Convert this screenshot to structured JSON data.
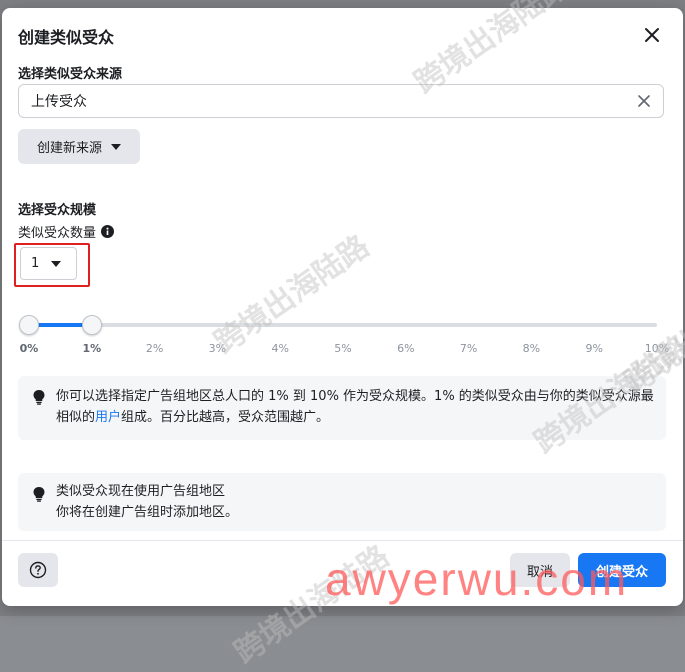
{
  "dialog": {
    "title": "创建类似受众",
    "source": {
      "label": "选择类似受众来源",
      "value": "上传受众",
      "new_source_button": "创建新来源"
    },
    "size": {
      "label": "选择受众规模",
      "count_label": "类似受众数量",
      "count_value": "1",
      "slider": {
        "ticks": [
          "0%",
          "1%",
          "2%",
          "3%",
          "4%",
          "5%",
          "6%",
          "7%",
          "8%",
          "9%",
          "10%"
        ],
        "range_start_percent": 0,
        "range_end_percent": 1
      }
    },
    "info1": {
      "text_before_link": "你可以选择指定广告组地区总人口的 1% 到 10% 作为受众规模。1% 的类似受众由与你的类似受众源最相似的",
      "link": "用户",
      "text_after_link": "组成。百分比越高，受众范围越广。"
    },
    "info2": {
      "line1": "类似受众现在使用广告组地区",
      "line2": "你将在创建广告组时添加地区。"
    },
    "footer": {
      "cancel": "取消",
      "create": "创建受众"
    }
  },
  "watermark": {
    "repeat_text": "跨境出海陆路",
    "brand": "awyerwu.com"
  },
  "colors": {
    "accent": "#1877f2",
    "highlight": "#e02020"
  }
}
